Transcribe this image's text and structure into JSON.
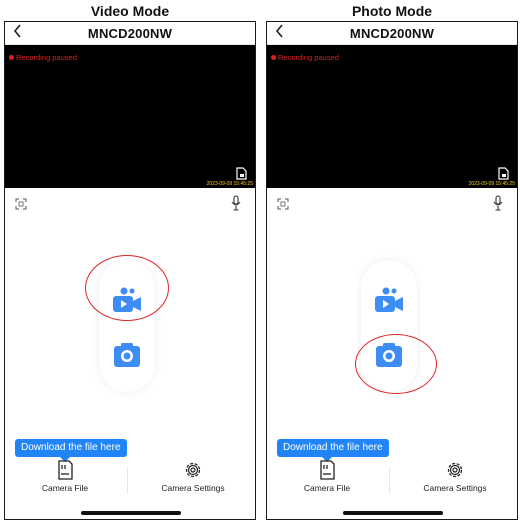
{
  "panels": [
    {
      "caption": "Video Mode",
      "title": "MNCD200NW",
      "recording_status": "Recording paused",
      "timestamp": "2023-09-09 15:45:25",
      "download_callout": "Download the file here",
      "tabs": {
        "files_label": "Camera File",
        "settings_label": "Camera Settings"
      },
      "highlighted_mode": "video"
    },
    {
      "caption": "Photo Mode",
      "title": "MNCD200NW",
      "recording_status": "Recording paused",
      "timestamp": "2023-09-09 15:45:25",
      "download_callout": "Download the file here",
      "tabs": {
        "files_label": "Camera File",
        "settings_label": "Camera Settings"
      },
      "highlighted_mode": "photo"
    }
  ],
  "icons": {
    "back": "chevron-left-icon",
    "file": "document-icon",
    "screenshot": "screenshot-icon",
    "mic": "microphone-icon",
    "video_mode": "video-camera-icon",
    "photo_mode": "camera-icon",
    "sd_card": "sd-card-icon",
    "settings": "gear-icon"
  },
  "colors": {
    "video_background": "#000000",
    "recording_status": "#e11d1d",
    "timestamp": "#f2d00f",
    "accent_blue": "#2185f7",
    "highlight_circle": "#e3242b"
  }
}
